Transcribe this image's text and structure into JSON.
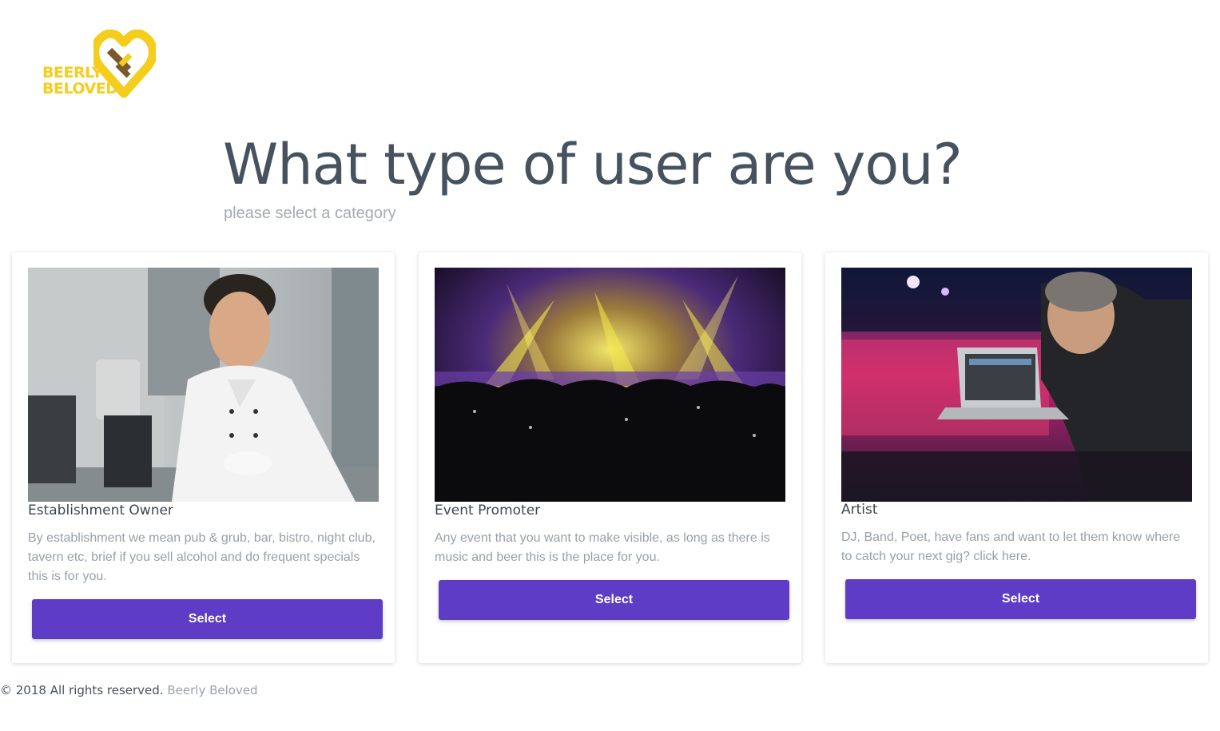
{
  "brand": {
    "line1": "BEERLY",
    "line2": "BELOVED",
    "logo_icon": "heart-logo-icon",
    "colors": {
      "yellow": "#f4cd1d",
      "brown": "#7a5a2c"
    }
  },
  "header": {
    "title": "What type of user are you?",
    "subtitle": "please select a category"
  },
  "cards": [
    {
      "image": "chef-with-coffee-image",
      "title": "Establishment Owner",
      "description": "By establishment we mean pub & grub, bar, bistro, night club, tavern etc, brief if you sell alcohol and do frequent specials this is for you.",
      "button_label": "Select"
    },
    {
      "image": "concert-crowd-image",
      "title": "Event Promoter",
      "description": "Any event that you want to make visible, as long as there is music and beer this is the place for you.",
      "button_label": "Select"
    },
    {
      "image": "dj-with-laptop-image",
      "title": "Artist",
      "description": "DJ, Band, Poet, have fans and want to let them know where to catch your next gig? click here.",
      "button_label": "Select"
    }
  ],
  "footer": {
    "copyright": "© 2018 All rights reserved.",
    "brand_link": "Beerly Beloved"
  },
  "colors": {
    "accent": "#5e3cc5",
    "heading": "#47525f",
    "muted": "#98a0a9"
  }
}
